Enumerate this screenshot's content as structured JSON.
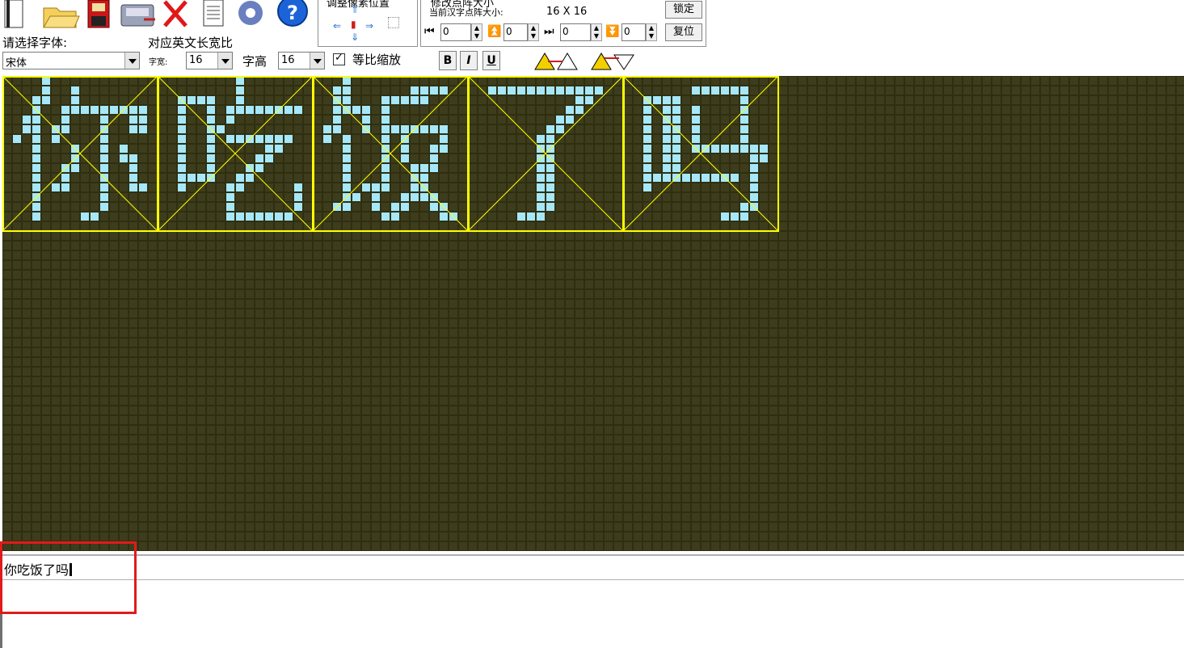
{
  "toolbar": {
    "icons": [
      "new-file-icon",
      "open-folder-icon",
      "save-icon",
      "export-icon",
      "delete-icon",
      "document-icon",
      "settings-icon",
      "help-icon"
    ],
    "help_glyph": "?",
    "adjust_pixel_title": "调整像素位置",
    "dot_size_title": "修改点阵大小",
    "current_size_label": "当前汉字点阵大小:",
    "current_size_value": "16  X  16",
    "lock_button": "锁定",
    "reset_button": "复位",
    "spin_values": [
      "0",
      "0",
      "0",
      "0"
    ]
  },
  "font": {
    "select_label": "请选择字体:",
    "selected": "宋体",
    "ratio_label": "对应英文长宽比",
    "width_label": "字宽:",
    "width_value": "16",
    "height_label": "字高",
    "height_value": "16",
    "proportional_label": "等比缩放",
    "proportional_checked": true,
    "check_glyph": "✓"
  },
  "format": {
    "bold": "B",
    "italic": "I",
    "underline": "U"
  },
  "colors": {
    "grid_background": "#2f2f10",
    "grid_cell": "#3d3d1e",
    "lit_pixel": "#a6e7fa",
    "cell_border": "#ffff00",
    "highlight_box": "#e21a1a"
  },
  "canvas": {
    "characters": [
      "你",
      "吃",
      "饭",
      "了",
      "吗"
    ],
    "dot_size": "16 X 16"
  },
  "input": {
    "text": "你吃饭了吗"
  }
}
